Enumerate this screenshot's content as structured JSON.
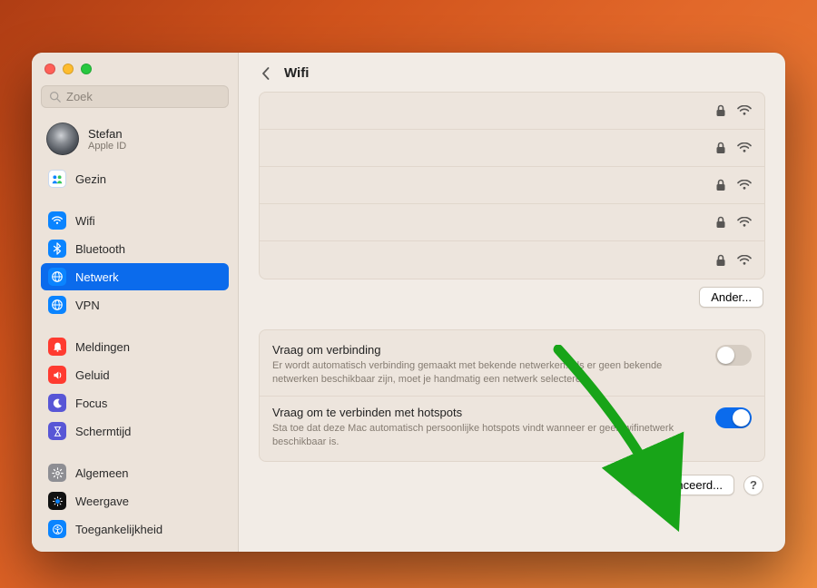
{
  "search": {
    "placeholder": "Zoek"
  },
  "user": {
    "name": "Stefan",
    "sub": "Apple ID"
  },
  "sidebar": {
    "gezin": "Gezin",
    "items": [
      {
        "id": "wifi",
        "label": "Wifi"
      },
      {
        "id": "bluetooth",
        "label": "Bluetooth"
      },
      {
        "id": "network",
        "label": "Netwerk",
        "selected": true
      },
      {
        "id": "vpn",
        "label": "VPN"
      }
    ],
    "items2": [
      {
        "id": "notifications",
        "label": "Meldingen"
      },
      {
        "id": "sound",
        "label": "Geluid"
      },
      {
        "id": "focus",
        "label": "Focus"
      },
      {
        "id": "screentime",
        "label": "Schermtijd"
      }
    ],
    "items3": [
      {
        "id": "general",
        "label": "Algemeen"
      },
      {
        "id": "display",
        "label": "Weergave"
      },
      {
        "id": "accessibility",
        "label": "Toegankelijkheid"
      }
    ]
  },
  "main": {
    "title": "Wifi",
    "network_rows": 5,
    "other_button": "Ander...",
    "ask_join": {
      "title": "Vraag om verbinding",
      "desc": "Er wordt automatisch verbinding gemaakt met bekende netwerken. Als er geen bekende netwerken beschikbaar zijn, moet je handmatig een netwerk selecteren.",
      "on": false
    },
    "ask_hotspot": {
      "title": "Vraag om te verbinden met hotspots",
      "desc": "Sta toe dat deze Mac automatisch persoonlijke hotspots vindt wanneer er geen wifinetwerk beschikbaar is.",
      "on": true
    },
    "advanced_button": "Geavanceerd...",
    "help": "?"
  },
  "icons": {
    "gezin": {
      "bg": "#ffffff",
      "stroke": "#0a84ff"
    },
    "wifi": {
      "bg": "#0a84ff"
    },
    "bluetooth": {
      "bg": "#0a84ff"
    },
    "network": {
      "bg": "#0a84ff"
    },
    "vpn": {
      "bg": "#0a84ff"
    },
    "notifications": {
      "bg": "#ff3b30"
    },
    "sound": {
      "bg": "#ff3b30"
    },
    "focus": {
      "bg": "#5856d6"
    },
    "screentime": {
      "bg": "#5856d6"
    },
    "general": {
      "bg": "#8e8e93"
    },
    "display": {
      "bg": "#111111"
    },
    "accessibility": {
      "bg": "#0a84ff"
    }
  }
}
